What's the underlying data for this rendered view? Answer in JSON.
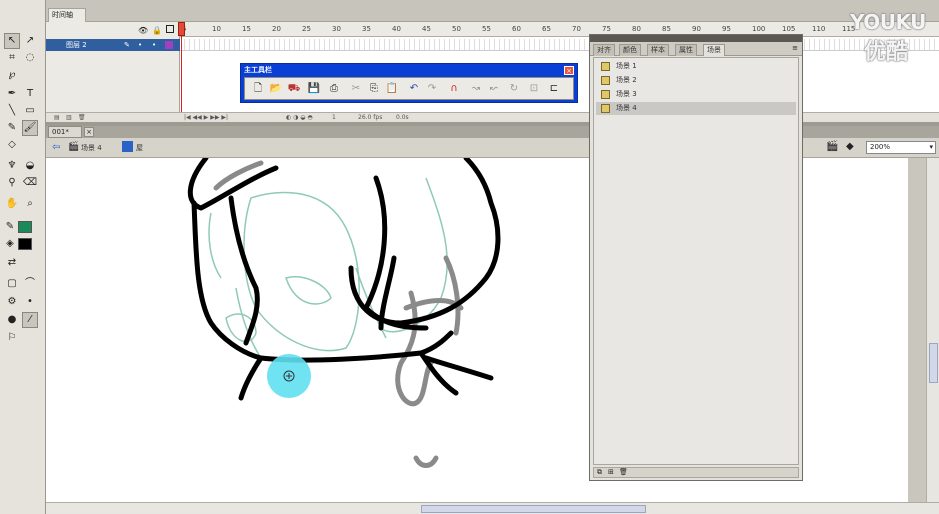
{
  "timeline": {
    "tab_label": "时间轴",
    "layer_name": "图层 2",
    "frame_ticks": [
      "5",
      "10",
      "15",
      "20",
      "25",
      "30",
      "35",
      "40",
      "45",
      "50",
      "55",
      "60",
      "65",
      "70",
      "75",
      "80",
      "85",
      "90",
      "95",
      "100",
      "105",
      "110",
      "115"
    ],
    "fps": "26.0 fps",
    "elapsed": "0.0s",
    "current_frame": "1"
  },
  "document": {
    "tab_label": "001*",
    "scene_name": "场景 4",
    "symbol_name": "屋",
    "zoom": "200%"
  },
  "main_toolbar": {
    "title": "主工具栏",
    "close_glyph": "×"
  },
  "panel": {
    "tabs": [
      "对齐",
      "颜色",
      "样本",
      "属性",
      "场景"
    ],
    "active_tab": "场景",
    "scenes": [
      "场景 1",
      "场景 2",
      "场景 3",
      "场景 4"
    ],
    "selected_scene": "场景 4"
  },
  "watermark": {
    "text_en": "YOUKU",
    "text_cn": "优酷"
  },
  "colors": {
    "stroke_swatch": "#1a8a5a",
    "fill_swatch": "#000000",
    "brush_cursor": "#5fe0f0",
    "layer_highlight": "#2f5f9e",
    "toolbar_title": "#0a3fd6"
  }
}
